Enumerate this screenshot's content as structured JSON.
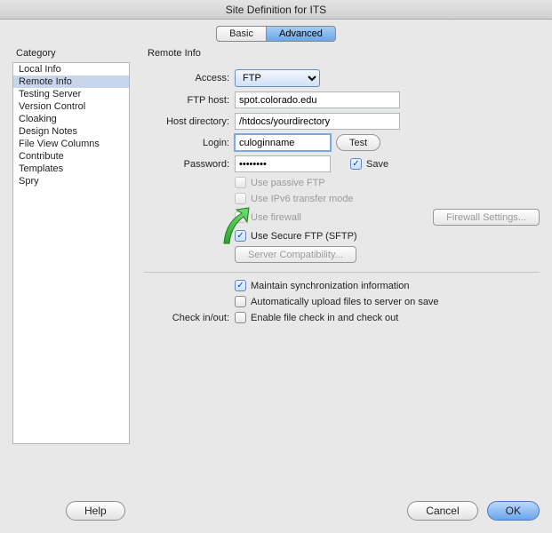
{
  "window": {
    "title": "Site Definition for ITS"
  },
  "tabs": {
    "basic": "Basic",
    "advanced": "Advanced",
    "active": "advanced"
  },
  "labels": {
    "category": "Category",
    "panelTitle": "Remote Info"
  },
  "category": {
    "items": [
      "Local Info",
      "Remote Info",
      "Testing Server",
      "Version Control",
      "Cloaking",
      "Design Notes",
      "File View Columns",
      "Contribute",
      "Templates",
      "Spry"
    ],
    "selectedIndex": 1
  },
  "form": {
    "access_label": "Access:",
    "access_value": "FTP",
    "ftphost_label": "FTP host:",
    "ftphost_value": "spot.colorado.edu",
    "hostdir_label": "Host directory:",
    "hostdir_value": "/htdocs/yourdirectory",
    "login_label": "Login:",
    "login_value": "culoginname",
    "test_label": "Test",
    "password_label": "Password:",
    "password_value": "••••••••",
    "save_label": "Save",
    "use_passive": "Use passive FTP",
    "use_ipv6": "Use IPv6 transfer mode",
    "use_firewall": "Use firewall",
    "firewall_settings": "Firewall Settings...",
    "use_sftp": "Use Secure FTP (SFTP)",
    "server_compat": "Server Compatibility...",
    "maintain_sync": "Maintain synchronization information",
    "auto_upload": "Automatically upload files to server on save",
    "checkinout_label": "Check in/out:",
    "enable_checkin": "Enable file check in and check out"
  },
  "footer": {
    "help": "Help",
    "cancel": "Cancel",
    "ok": "OK"
  }
}
